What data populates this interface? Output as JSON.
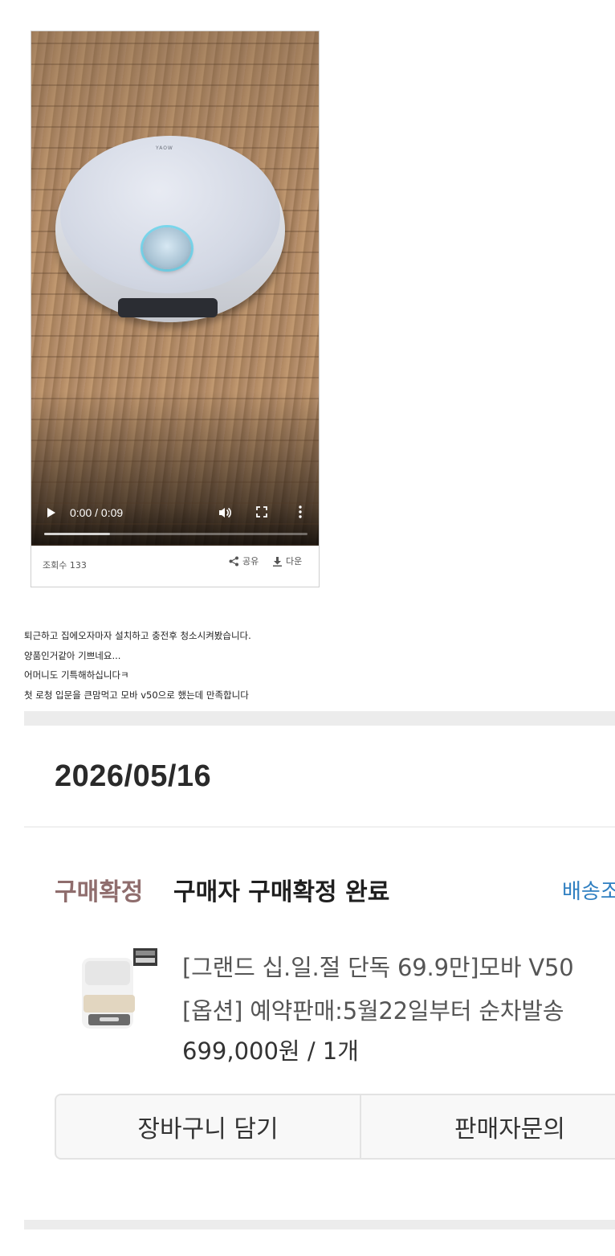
{
  "video": {
    "brand_text": "YAOW",
    "time_display": "0:00 / 0:09",
    "progress_fraction": 0.0,
    "views_label": "조회수 133",
    "share_label": "공유",
    "download_label": "다운"
  },
  "post": {
    "lines": [
      "퇴근하고 집에오자마자 설치하고 충전후 청소시켜봤습니다.",
      "양품인거같아 기쁘네요...",
      "어머니도 기특해하십니다ㅋ",
      "첫 로청 입문을 큰맘먹고 모바 v50으로 했는데 만족합니다"
    ]
  },
  "order": {
    "date": "2026/05/16",
    "status_tag": "구매확정",
    "status_text": "구매자 구매확정 완료",
    "delivery_link": "배송조",
    "product_title": "[그랜드 십.일.절 단독 69.9만]모바 V50",
    "product_option": "[옵션] 예약판매:5월22일부터 순차발송",
    "product_price": "699,000원 / 1개",
    "cart_button": "장바구니 담기",
    "inquiry_button": "판매자문의"
  },
  "colors": {
    "status_tag": "#8f6d6d",
    "delivery_link": "#2f7fc1",
    "lds_ring": "#5ad2eb"
  }
}
